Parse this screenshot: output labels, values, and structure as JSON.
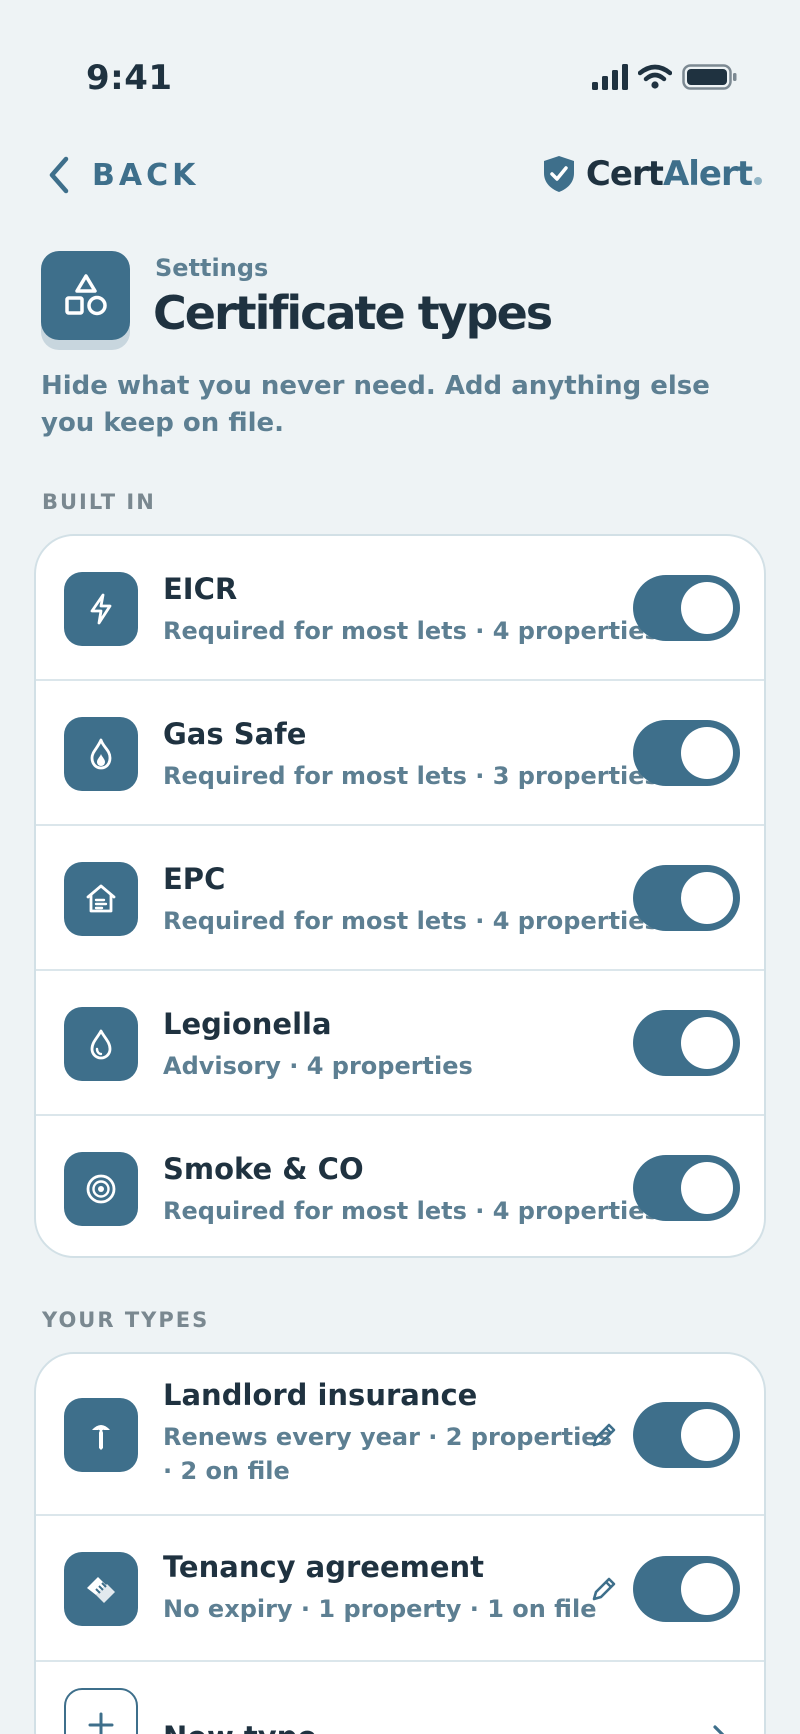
{
  "status": {
    "time": "9:41"
  },
  "nav": {
    "back_label": "BACK",
    "brand_cert": "Cert",
    "brand_alert": "Alert"
  },
  "header": {
    "eyebrow": "Settings",
    "title": "Certificate types",
    "subtitle": "Hide what you never need. Add anything else you keep on file."
  },
  "built_in": {
    "label": "BUILT IN",
    "items": [
      {
        "title": "EICR",
        "sub": "Required for most lets · 4 properties",
        "enabled": true,
        "icon": "bolt-icon"
      },
      {
        "title": "Gas Safe",
        "sub": "Required for most lets · 3 properties",
        "enabled": true,
        "icon": "flame-icon"
      },
      {
        "title": "EPC",
        "sub": "Required for most lets · 4 properties",
        "enabled": true,
        "icon": "house-icon"
      },
      {
        "title": "Legionella",
        "sub": "Advisory · 4 properties",
        "enabled": true,
        "icon": "droplet-icon"
      },
      {
        "title": "Smoke & CO",
        "sub": "Required for most lets · 4 properties",
        "enabled": true,
        "icon": "alarm-icon"
      }
    ]
  },
  "your_types": {
    "label": "YOUR TYPES",
    "items": [
      {
        "title": "Landlord insurance",
        "sub_line1": "Renews every year · 2 properties",
        "sub_line2": "· 2 on file",
        "enabled": true,
        "icon": "umbrella-icon"
      },
      {
        "title": "Tenancy agreement",
        "sub_line1": "No expiry · 1 property · 1 on file",
        "enabled": true,
        "icon": "handshake-icon"
      }
    ],
    "new_type_label": "New type"
  },
  "colors": {
    "accent": "#3e6f8b",
    "background": "#eef3f5",
    "text": "#1f3240",
    "muted": "#5d7f92"
  }
}
